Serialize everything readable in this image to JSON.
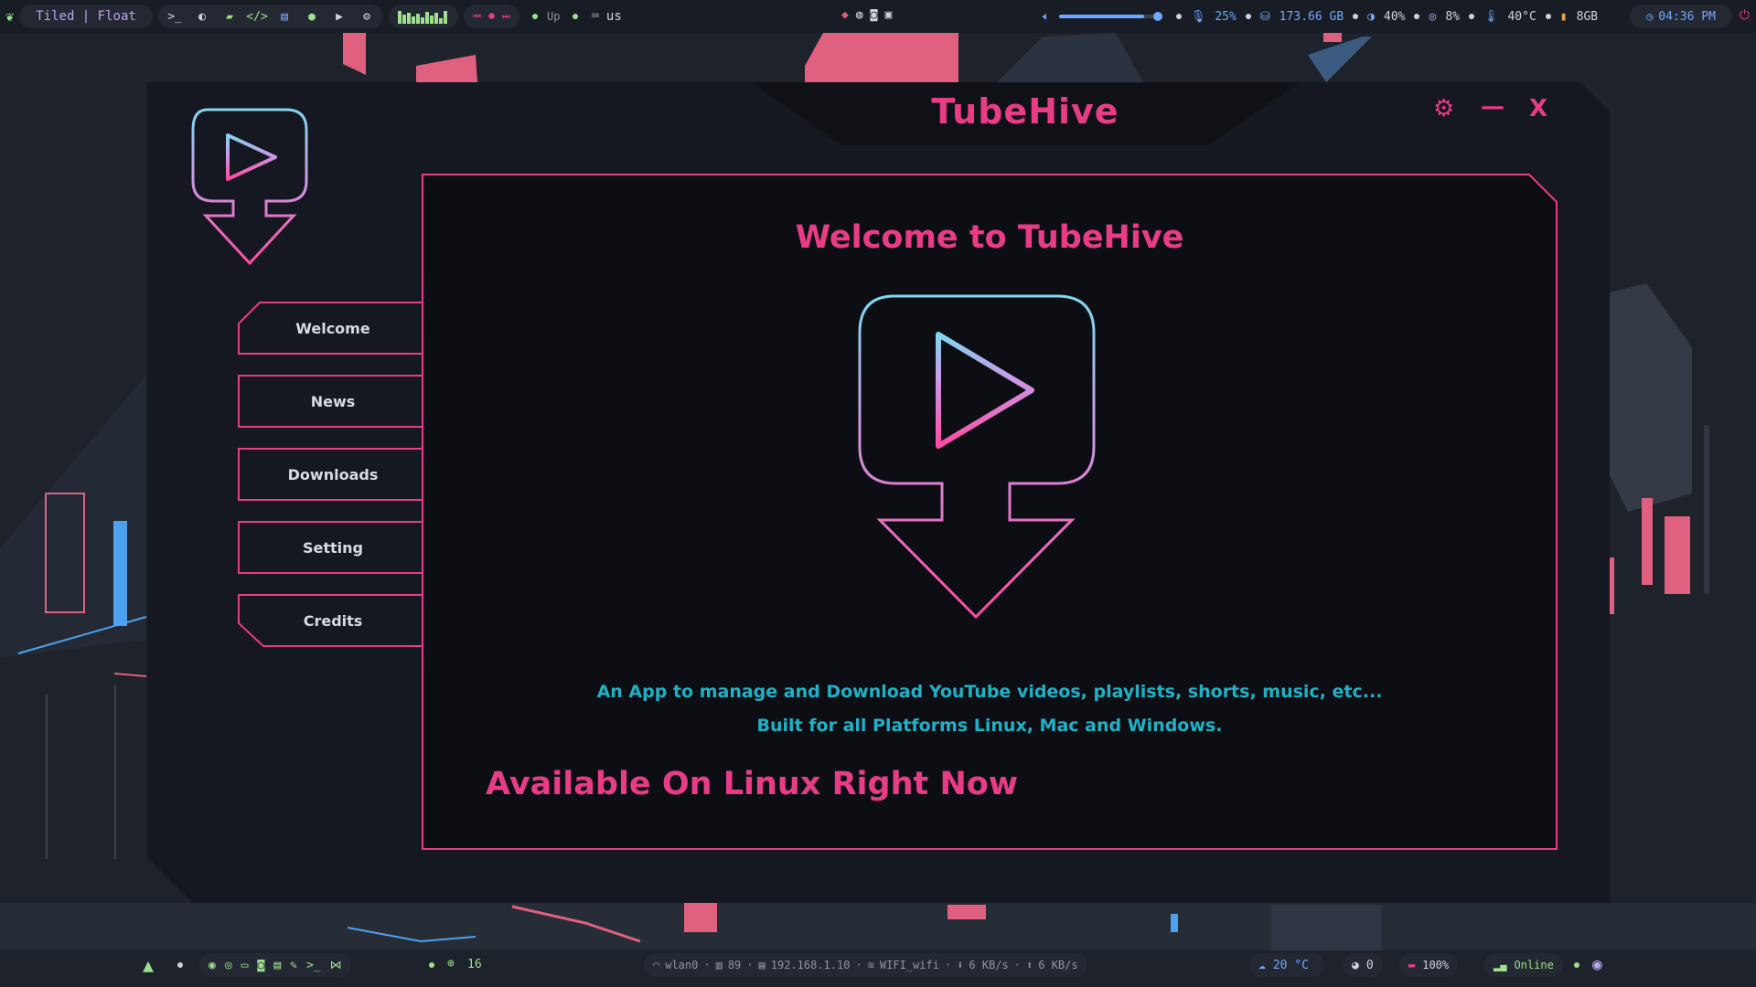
{
  "topbar": {
    "layout_label": "Tiled | Float",
    "launcher_icons": [
      "terminal-icon",
      "firefox-icon",
      "files-icon",
      "code-icon",
      "notes-icon",
      "chat-icon",
      "youtube-icon",
      "settings-icon"
    ],
    "updates_label": "Up",
    "keyboard_layout": "us",
    "volume_percent": 85,
    "mic_level": "25%",
    "disk": "173.66 GB",
    "brightness": "40%",
    "cpu": "8%",
    "temperature": "40°C",
    "memory": "8GB",
    "clock": "04:36 PM"
  },
  "app": {
    "title": "TubeHive",
    "nav": [
      {
        "label": "Welcome"
      },
      {
        "label": "News"
      },
      {
        "label": "Downloads"
      },
      {
        "label": "Setting"
      },
      {
        "label": "Credits"
      }
    ],
    "controls": {
      "settings": "⚙",
      "minimize": "—",
      "close": "X"
    },
    "main": {
      "heading": "Welcome to TubeHive",
      "description_line1": "An App to manage and Download YouTube videos, playlists, shorts, music, etc...",
      "description_line2": "Built for all Platforms Linux, Mac and Windows.",
      "availability": "Available On Linux Right Now"
    }
  },
  "bottombar": {
    "workspace_count": "16",
    "network_interface": "wlan0",
    "signal": "89",
    "ip": "192.168.1.10",
    "ssid": "WIFI_wifi",
    "download_speed": "6 KB/s",
    "upload_speed": "6 KB/s",
    "weather": "20 °C",
    "github_notifications": "0",
    "battery": "100%",
    "status": "Online"
  },
  "colors": {
    "accent_pink": "#e83c86",
    "accent_cyan": "#1fb2c6",
    "window_bg": "#151820",
    "panel_bg": "#0c0e14"
  }
}
